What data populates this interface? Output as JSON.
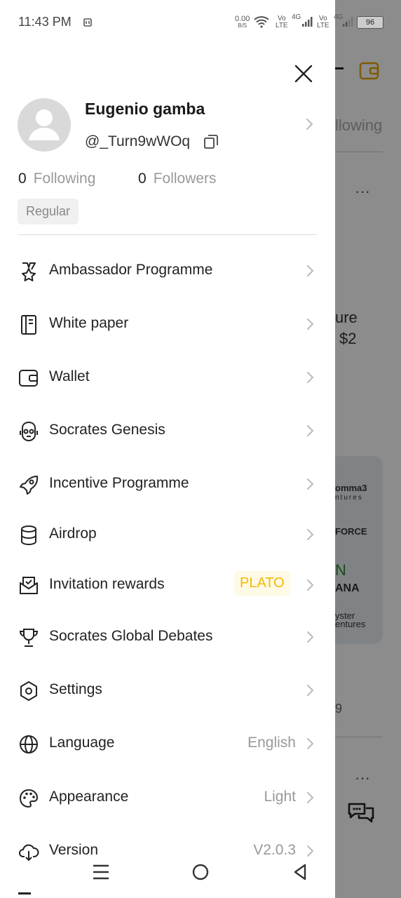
{
  "status_bar": {
    "time": "11:43 PM",
    "net_speed_value": "0.00",
    "net_speed_unit": "B/S",
    "battery": "96",
    "vo1": "Vo",
    "lte1": "LTE",
    "g1": "4G",
    "vo2": "Vo",
    "lte2": "LTE",
    "g2": "4G"
  },
  "background": {
    "following_tab": "llowing",
    "ure": "ure",
    "price": "$2",
    "partner1": "omma3",
    "partner1_sub": "ntures",
    "partner2": "FORCE",
    "partner3": "N",
    "partner4": "ANA",
    "partner5": "yster",
    "partner5_sub": "entures",
    "num": "9"
  },
  "profile": {
    "name": "Eugenio gamba",
    "handle": "@_Turn9wWOq",
    "following_count": "0",
    "following_label": "Following",
    "followers_count": "0",
    "followers_label": "Followers",
    "badge": "Regular"
  },
  "menu": [
    {
      "label": "Ambassador Programme",
      "icon": "medal-icon"
    },
    {
      "label": "White paper",
      "icon": "book-icon"
    },
    {
      "label": "Wallet",
      "icon": "wallet-icon"
    },
    {
      "label": "Socrates Genesis",
      "icon": "robot-icon"
    },
    {
      "label": "Incentive Programme",
      "icon": "rocket-icon"
    },
    {
      "label": "Airdrop",
      "icon": "database-icon"
    },
    {
      "label": "Invitation rewards",
      "icon": "envelope-icon",
      "tag": "PLATO"
    },
    {
      "label": "Socrates Global Debates",
      "icon": "trophy-icon"
    },
    {
      "label": "Settings",
      "icon": "hexagon-settings-icon"
    },
    {
      "label": "Language",
      "icon": "globe-icon",
      "value": "English"
    },
    {
      "label": "Appearance",
      "icon": "palette-icon",
      "value": "Light"
    },
    {
      "label": "Version",
      "icon": "cloud-download-icon",
      "value": "V2.0.3"
    }
  ],
  "colors": {
    "accent": "#f5b800",
    "muted": "#999999",
    "overlay": "#737373"
  }
}
